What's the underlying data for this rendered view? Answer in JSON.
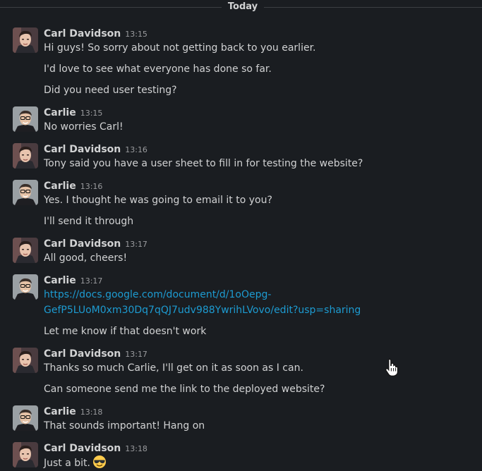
{
  "divider": {
    "label": "Today"
  },
  "messages": [
    {
      "author": "Carl Davidson",
      "time": "13:15",
      "lines": [
        "Hi guys! So sorry about not getting back to you earlier.",
        "I'd love to see what everyone has done so far.",
        "Did you need user testing?"
      ]
    },
    {
      "author": "Carlie",
      "time": "13:15",
      "lines": [
        "No worries Carl!"
      ]
    },
    {
      "author": "Carl Davidson",
      "time": "13:16",
      "lines": [
        "Tony said you have a user sheet to fill in for testing the website?"
      ]
    },
    {
      "author": "Carlie",
      "time": "13:16",
      "lines": [
        "Yes. I thought he was going to email it to you?",
        "I'll send it through"
      ]
    },
    {
      "author": "Carl Davidson",
      "time": "13:17",
      "lines": [
        "All good, cheers!"
      ]
    },
    {
      "author": "Carlie",
      "time": "13:17",
      "link": "https://docs.google.com/document/d/1oOepg-GefP5LUoM0xm30Dq7qQJ7udv988YwrihLVovo/edit?usp=sharing",
      "lines": [
        "Let me know if that doesn't work"
      ]
    },
    {
      "author": "Carl Davidson",
      "time": "13:17",
      "lines": [
        "Thanks so much Carlie, I'll get on it as soon as I can.",
        "Can someone send me the link to the deployed website?"
      ]
    },
    {
      "author": "Carlie",
      "time": "13:18",
      "lines": [
        "That sounds important! Hang on"
      ]
    },
    {
      "author": "Carl Davidson",
      "time": "13:18",
      "lines": [
        "Just a bit."
      ],
      "emoji": "smiling-face-with-sunglasses-emoji"
    }
  ],
  "colors": {
    "background": "#1a1d21",
    "text": "#d1d2d3",
    "link": "#1d9bd1",
    "timestamp": "#9a9b9e"
  }
}
